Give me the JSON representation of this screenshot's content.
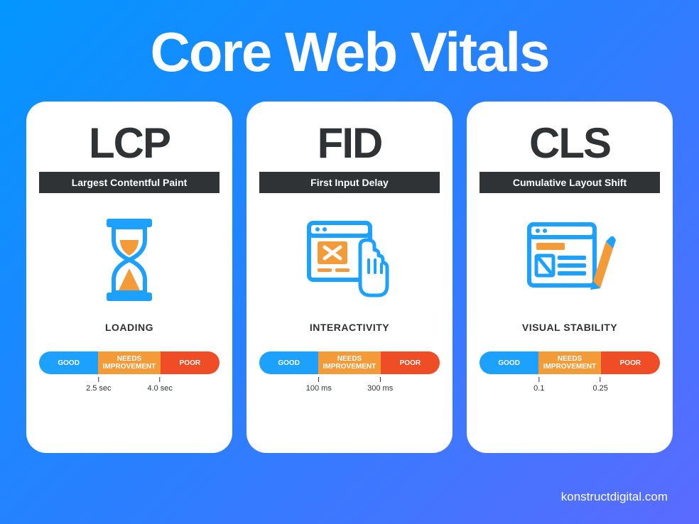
{
  "title": "Core Web Vitals",
  "footer": "konstructdigital.com",
  "gaugeLabels": {
    "good": "GOOD",
    "needs": "NEEDS IMPROVEMENT",
    "poor": "POOR"
  },
  "cards": [
    {
      "abbr": "LCP",
      "fullname": "Largest Contentful Paint",
      "category": "LOADING",
      "threshold1": "2.5 sec",
      "threshold2": "4.0 sec"
    },
    {
      "abbr": "FID",
      "fullname": "First Input Delay",
      "category": "INTERACTIVITY",
      "threshold1": "100 ms",
      "threshold2": "300 ms"
    },
    {
      "abbr": "CLS",
      "fullname": "Cumulative Layout Shift",
      "category": "VISUAL STABILITY",
      "threshold1": "0.1",
      "threshold2": "0.25"
    }
  ]
}
